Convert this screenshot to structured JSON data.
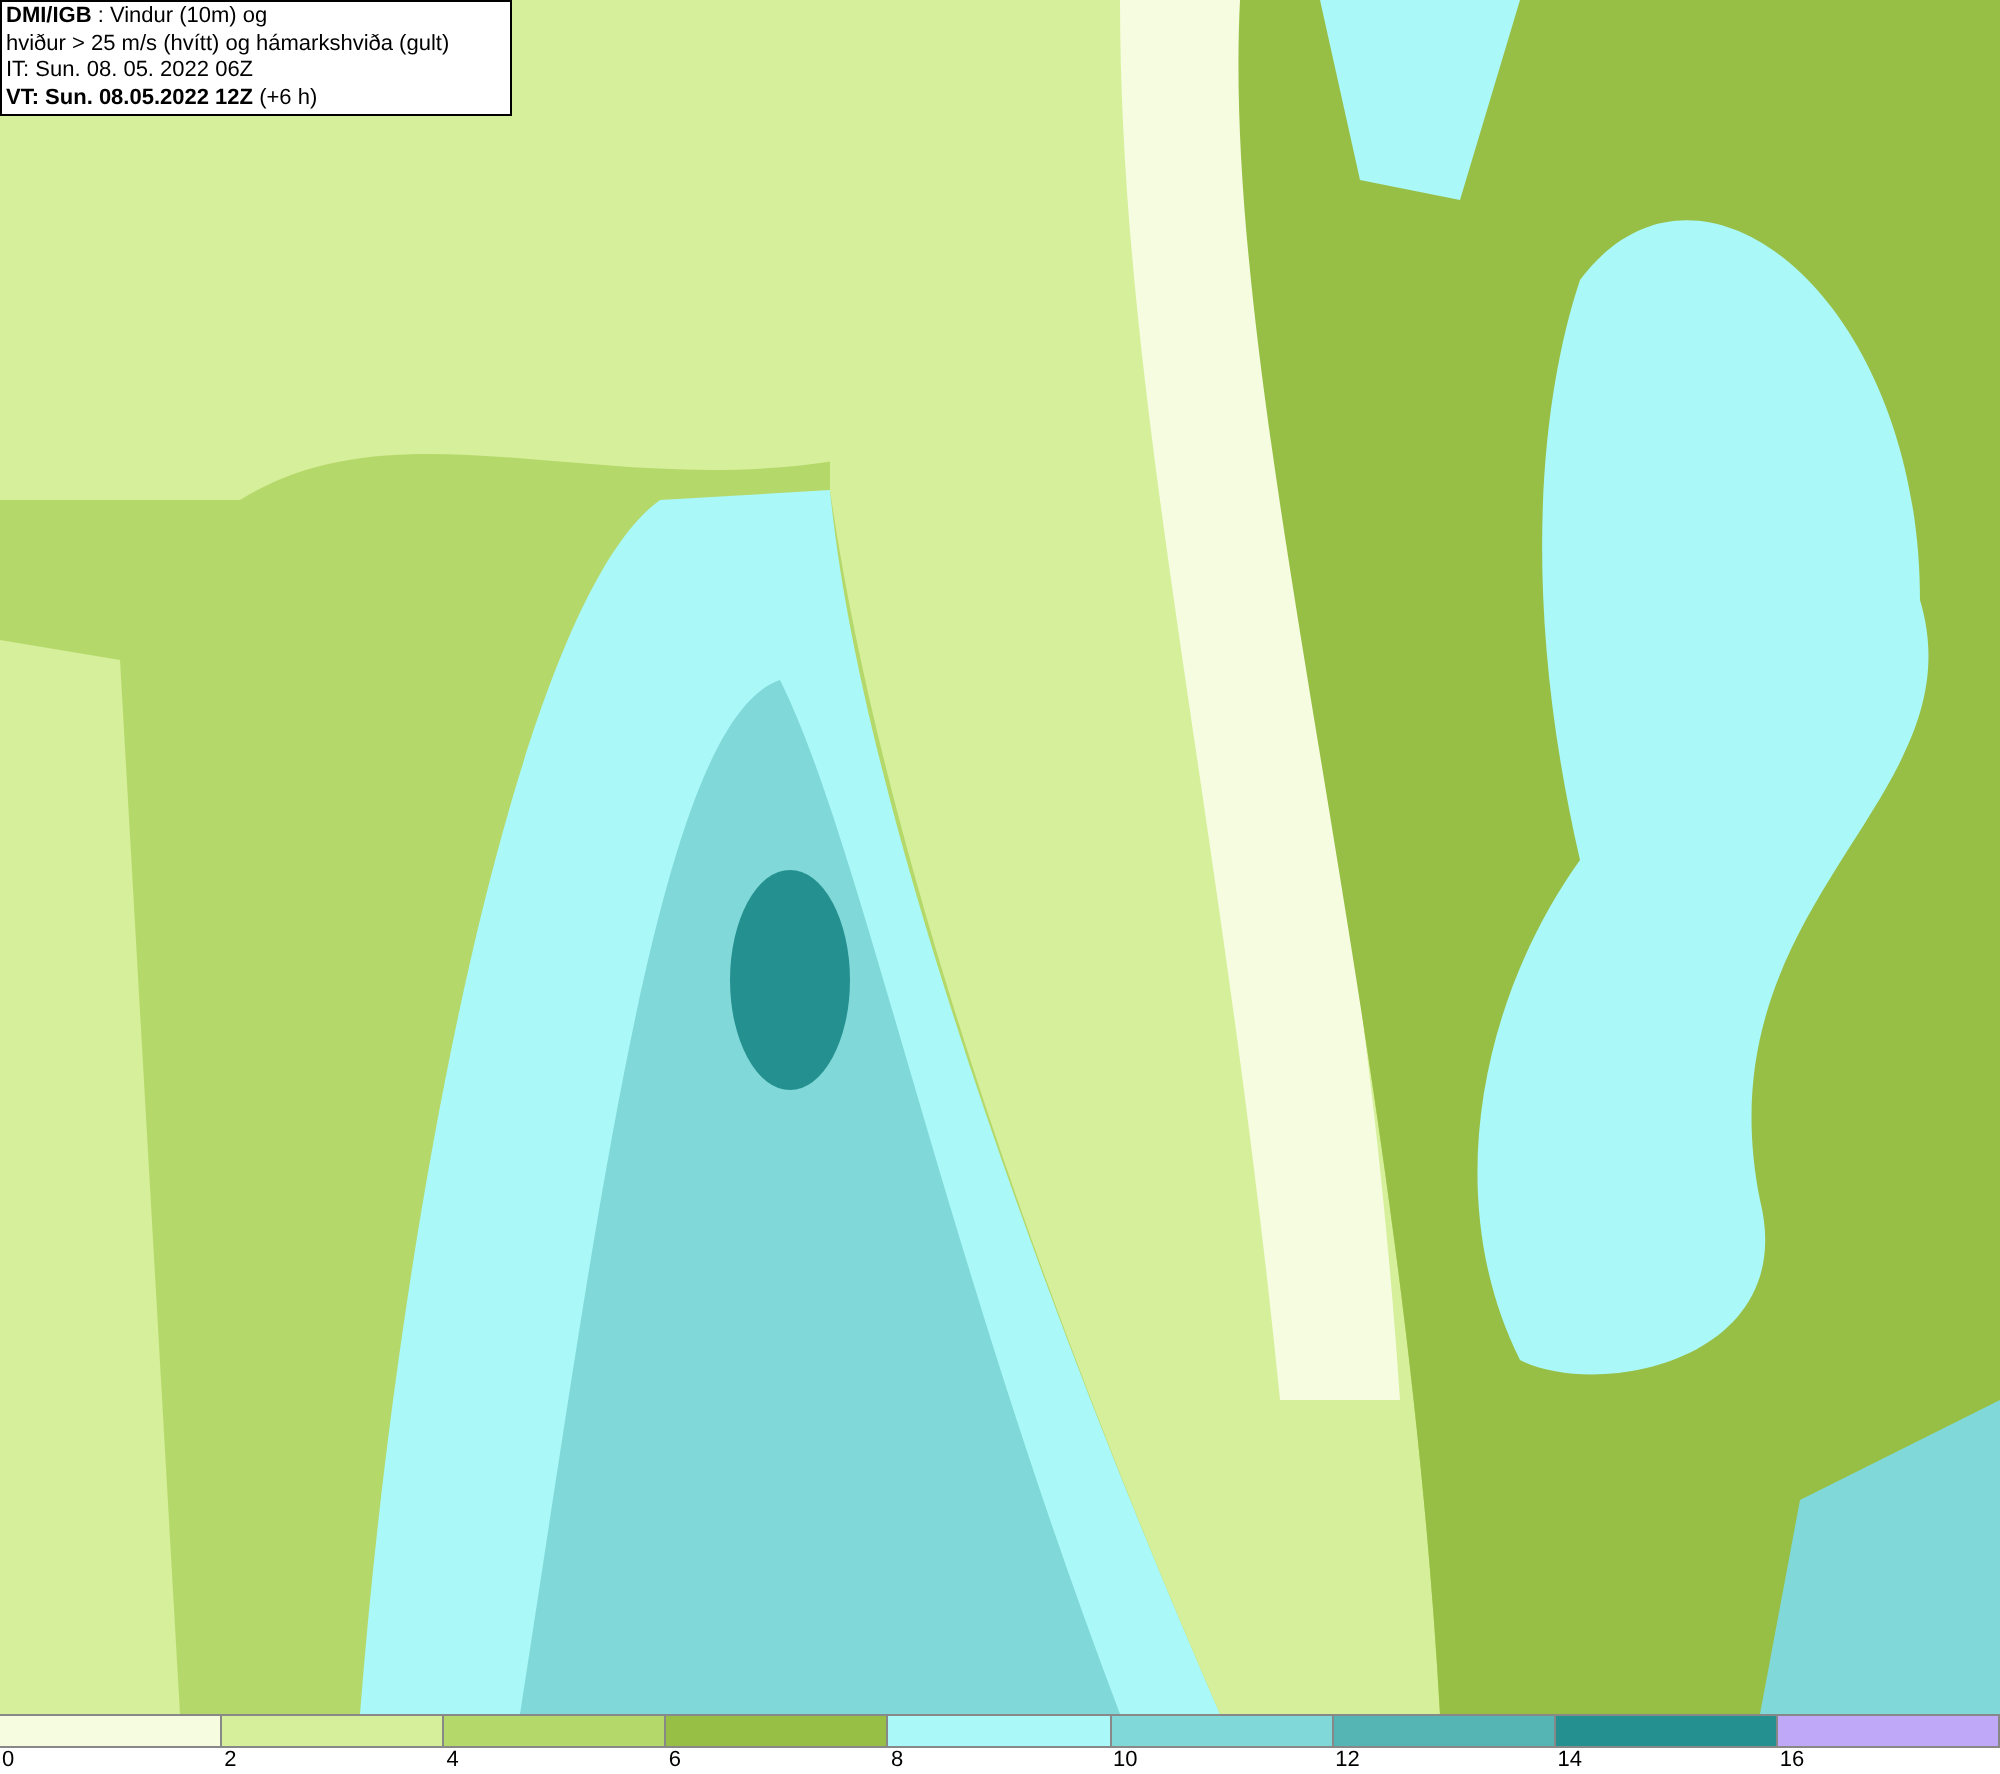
{
  "header": {
    "lines": [
      "**DMI/IGB** : Vindur (10m) og",
      "hviður > 25 m/s (hvítt) og hámarkshviða (gult)",
      "IT: Sun. 08. 05. 2022 06Z",
      "**VT: Sun. 08.05.2022 12Z** (+6 h)"
    ]
  },
  "legend": {
    "bins": [
      {
        "color": "#f5fce0"
      },
      {
        "color": "#d6ef9a"
      },
      {
        "color": "#b5d86a"
      },
      {
        "color": "#98bf45"
      },
      {
        "color": "#aaf8f8"
      },
      {
        "color": "#80d8d8"
      },
      {
        "color": "#55b4b4"
      },
      {
        "color": "#259090"
      },
      {
        "color": "#c0a8f8"
      }
    ],
    "labels": [
      "0",
      "2",
      "4",
      "6",
      "8",
      "10",
      "12",
      "14",
      "16"
    ]
  }
}
